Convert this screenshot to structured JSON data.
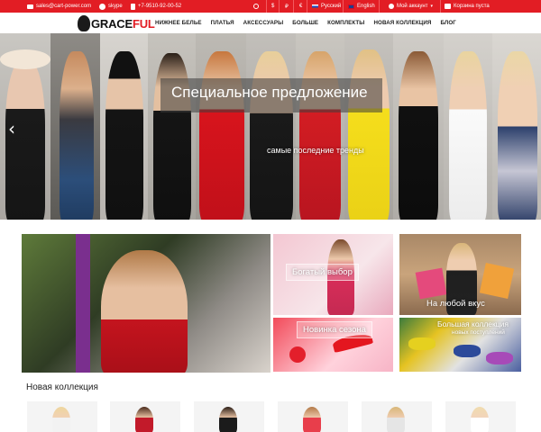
{
  "topbar": {
    "email": "sales@cart-power.com",
    "skype": "skype",
    "phone": "+7-9510-92-00-52",
    "currency_dollar": "$",
    "currency_ruble": "₽",
    "currency_euro": "€",
    "lang_ru": "Русский",
    "lang_en": "English",
    "account": "Мой аккаунт",
    "cart": "Корзина пуста",
    "accent_color": "#e21d24"
  },
  "logo": {
    "part1": "GRACE",
    "part2": "FUL"
  },
  "nav": {
    "items": [
      "НИЖНЕЕ БЕЛЬЕ",
      "ПЛАТЬЯ",
      "АКСЕССУАРЫ",
      "БОЛЬШЕ",
      "КОМПЛЕКТЫ",
      "НОВАЯ КОЛЛЕКЦИЯ",
      "БЛОГ"
    ]
  },
  "hero": {
    "title": "Специальное предложение",
    "subtitle": "самые последние тренды"
  },
  "promos": {
    "wide_choice": "Богатый выбор",
    "any_taste": "На любой вкус",
    "season_new": "Новинка сезона",
    "big_collection": "Большая коллекция",
    "new_arrivals": "новых поступлений"
  },
  "section": {
    "new_collection": "Новая коллекция"
  }
}
